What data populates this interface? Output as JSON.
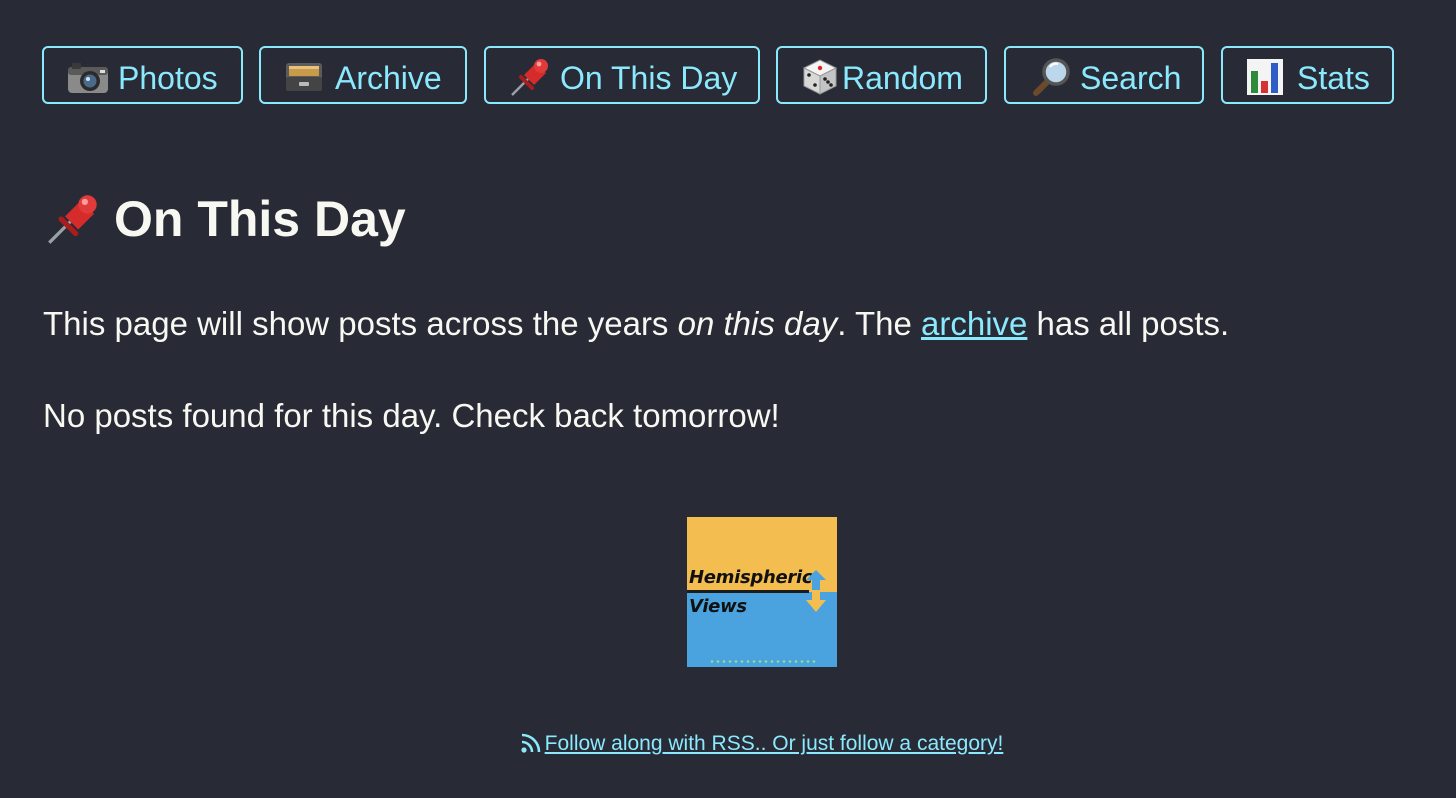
{
  "nav": {
    "items": [
      {
        "label": "Photos",
        "icon": "camera-icon"
      },
      {
        "label": "Archive",
        "icon": "file-cabinet-icon"
      },
      {
        "label": "On This Day",
        "icon": "pushpin-icon"
      },
      {
        "label": "Random",
        "icon": "dice-icon"
      },
      {
        "label": "Search",
        "icon": "magnifying-glass-icon"
      },
      {
        "label": "Stats",
        "icon": "bar-chart-icon"
      }
    ]
  },
  "page": {
    "title": "On This Day",
    "title_icon": "pushpin-icon",
    "intro_before": "This page will show posts across the years ",
    "intro_emphasis": "on this day",
    "intro_middle": ". The ",
    "intro_link": "archive",
    "intro_after": " has all posts.",
    "empty_message": "No posts found for this day. Check back tomorrow!"
  },
  "logo": {
    "line1": "Hemispheric",
    "line2": "Views"
  },
  "footer": {
    "rss_icon": "rss-icon",
    "link_text": "Follow along with RSS.. Or just follow a category!"
  },
  "colors": {
    "background": "#282a36",
    "accent": "#8be9fd",
    "text": "#f8f8f2"
  }
}
